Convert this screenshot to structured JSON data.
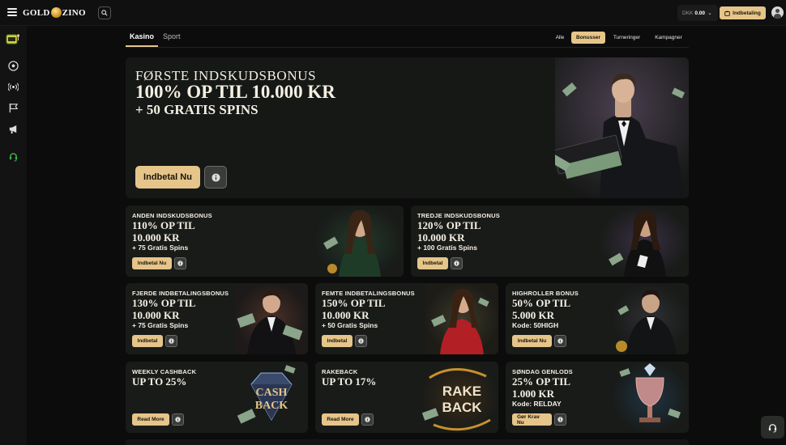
{
  "header": {
    "logo_left": "GOLD",
    "logo_right": "ZINO",
    "balance_currency": "DKK",
    "balance_amount": "0.00",
    "deposit_label": "Indbetaling"
  },
  "tabs": [
    {
      "label": "Kasino",
      "active": true
    },
    {
      "label": "Sport",
      "active": false
    }
  ],
  "filters": [
    {
      "label": "Alle",
      "active": false
    },
    {
      "label": "Bonusser",
      "active": true
    },
    {
      "label": "Turneringer",
      "active": false
    },
    {
      "label": "Kampagner",
      "active": false
    }
  ],
  "hero": {
    "line1": "FØRSTE INDSKUDSBONUS",
    "line2": "100% OP TIL 10.000 KR",
    "line3": "+ 50 GRATIS SPINS",
    "button": "Indbetal Nu"
  },
  "cards": [
    {
      "label": "ANDEN INDSKUDSBONUS",
      "big1": "110% OP TIL",
      "big2": "10.000 KR",
      "small": "+ 75 Gratis Spins",
      "button": "Indbetal Nu"
    },
    {
      "label": "TREDJE INDSKUDSBONUS",
      "big1": "120% OP TIL",
      "big2": "10.000 KR",
      "small": "+ 100 Gratis Spins",
      "button": "Indbetal"
    },
    {
      "label": "FJERDE INDBETALINGSBONUS",
      "big1": "130% OP TIL",
      "big2": "10.000 KR",
      "small": "+ 75 Gratis Spins",
      "button": "Indbetal"
    },
    {
      "label": "FEMTE INDBETALINGSBONUS",
      "big1": "150% OP TIL",
      "big2": "10.000 KR",
      "small": "+ 50 Gratis Spins",
      "button": "Indbetal"
    },
    {
      "label": "HIGHROLLER BONUS",
      "big1": "50% OP TIL",
      "big2": "5.000 KR",
      "small": "Kode: 50HIGH",
      "button": "Indbetal Nu"
    },
    {
      "label": "WEEKLY CASHBACK",
      "big1": "UP TO 25%",
      "big2": "",
      "small": "",
      "button": "Read More",
      "art_text1": "CASH",
      "art_text2": "BACK"
    },
    {
      "label": "RAKEBACK",
      "big1": "UP TO 17%",
      "big2": "",
      "small": "",
      "button": "Read More",
      "art_text1": "RAKE",
      "art_text2": "BACK"
    },
    {
      "label": "SØNDAG GENLODS",
      "big1": "25% OP TIL",
      "big2": "1.000 KR",
      "small": "Kode: RELDAY",
      "button": "Gør Krav Nu"
    }
  ],
  "colors": {
    "accent": "#e6c58a",
    "background": "#0b0c0b",
    "card": "#191b19"
  }
}
